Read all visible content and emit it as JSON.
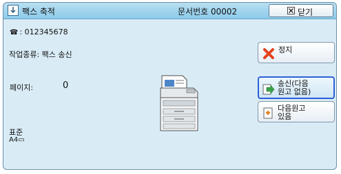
{
  "title_bar": {
    "title": "팩스 축적",
    "doc_number": "문서번호 00002",
    "close_label": "닫기"
  },
  "info": {
    "fax_number": ": 012345678",
    "job_type": "작업종류: 팩스 송신",
    "pages_label": "페이지:",
    "pages_value": "0",
    "quality": "표준",
    "paper_size": "A4▭"
  },
  "buttons": {
    "stop_label": "정지",
    "send_line1": "송신(다음",
    "send_line2": "원고 없음)",
    "next_line1": "다음원고",
    "next_line2": "있음"
  },
  "colors": {
    "panel_bg": "#d9ecf6",
    "titlebar": "#8ccbea",
    "active_border": "#2d5fd7",
    "stop_icon": "#e3431e"
  }
}
